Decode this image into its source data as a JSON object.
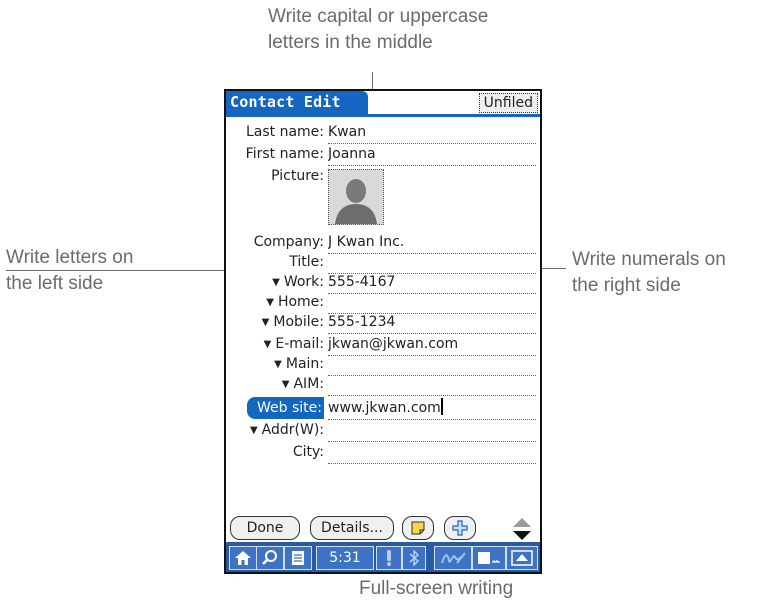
{
  "callouts": {
    "top_line1": "Write capital or uppercase",
    "top_line2": "letters in the middle",
    "left_line1": "Write letters on",
    "left_line2": "the left side",
    "right_line1": "Write numerals on",
    "right_line2": "the right side",
    "bottom": "Full-screen writing"
  },
  "app": {
    "title": "Contact Edit",
    "category": "Unfiled"
  },
  "fields": [
    {
      "label": "Last name:",
      "value": "Kwan"
    },
    {
      "label": "First name:",
      "value": "Joanna"
    },
    {
      "label": "Picture:",
      "value": ""
    },
    {
      "label": "Company:",
      "value": "J Kwan Inc."
    },
    {
      "label": "Title:",
      "value": ""
    },
    {
      "label": "Work:",
      "value": "555-4167"
    },
    {
      "label": "Home:",
      "value": ""
    },
    {
      "label": "Mobile:",
      "value": "555-1234"
    },
    {
      "label": "E-mail:",
      "value": "jkwan@jkwan.com"
    },
    {
      "label": "Main:",
      "value": ""
    },
    {
      "label": "AIM:",
      "value": ""
    },
    {
      "label": "Web site:",
      "value": "www.jkwan.com"
    },
    {
      "label": "Addr(W):",
      "value": ""
    },
    {
      "label": "City:",
      "value": ""
    }
  ],
  "buttons": {
    "done": "Done",
    "details": "Details..."
  },
  "statusbar": {
    "time": "5:31"
  },
  "icons": {
    "home": "home-icon",
    "find": "search-icon",
    "menu": "menu-icon",
    "alert": "alert-icon",
    "bluetooth": "bluetooth-icon",
    "fullscreen_writing": "full-screen-writing-icon",
    "input_area": "input-area-icon",
    "toggle_writing": "writing-area-toggle-icon",
    "note": "note-icon",
    "new": "plus-icon"
  },
  "colors": {
    "accent": "#1566c0",
    "callout_text": "#6b6b6b",
    "statusbar": "#2a5aa3"
  }
}
